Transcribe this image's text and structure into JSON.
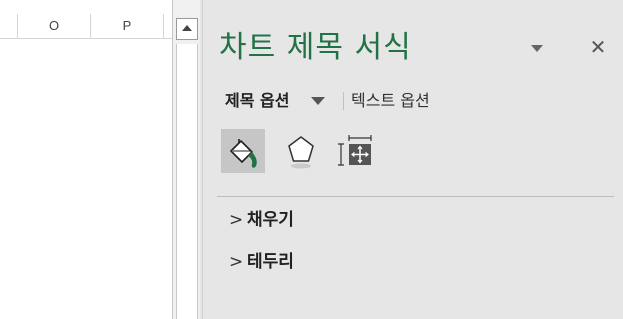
{
  "spreadsheet": {
    "column_headers": [
      "O",
      "P"
    ]
  },
  "pane": {
    "title": "차트 제목 서식",
    "tabs": {
      "title_options": "제목 옵션",
      "text_options": "텍스트 옵션"
    },
    "category_icons": [
      "fill-line-icon",
      "effects-icon",
      "size-properties-icon"
    ],
    "sections": [
      {
        "chevron": ">",
        "label": "채우기"
      },
      {
        "chevron": ">",
        "label": "테두리"
      }
    ],
    "close_glyph": "✕"
  },
  "colors": {
    "accent_green": "#217346",
    "pane_background": "#e6e6e6",
    "selected_icon_background": "#c6c6c6"
  }
}
